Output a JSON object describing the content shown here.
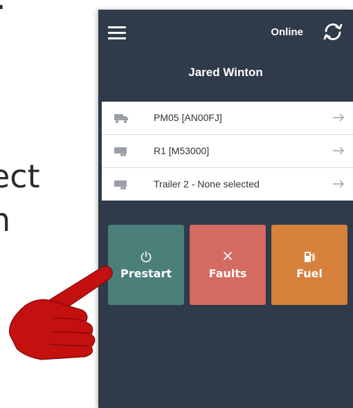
{
  "background_text": {
    "dot": ".",
    "line1": "ect",
    "line2": "n"
  },
  "header": {
    "status": "Online",
    "menu_icon": "hamburger-menu-icon",
    "sync_icon": "sync-icon"
  },
  "user": {
    "name": "Jared Winton"
  },
  "vehicles": [
    {
      "label": "PM05 [AN00FJ]",
      "icon": "truck-icon"
    },
    {
      "label": "R1 [M53000]",
      "icon": "trailer-icon"
    },
    {
      "label": "Trailer 2 - None selected",
      "icon": "trailer-icon"
    }
  ],
  "tiles": [
    {
      "label": "Prestart",
      "icon": "power-icon",
      "color": "#4b7f7a"
    },
    {
      "label": "Faults",
      "icon": "close-x-icon",
      "color": "#d46b63"
    },
    {
      "label": "Fuel",
      "icon": "fuel-pump-icon",
      "color": "#d6813c"
    }
  ],
  "colors": {
    "app_background": "#2f3a4a",
    "pointer_hand": "#c4100f"
  }
}
